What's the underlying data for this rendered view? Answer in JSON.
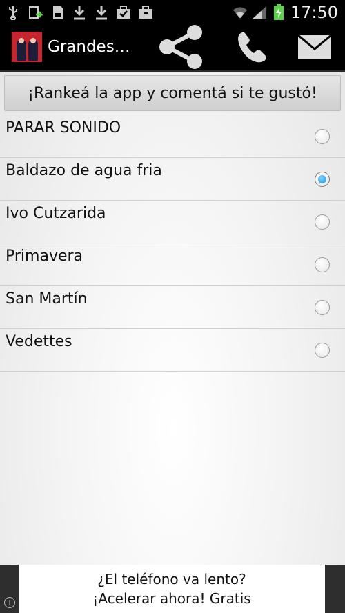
{
  "status_bar": {
    "time": "17:50",
    "icons": [
      "usb-icon",
      "refresh-icon",
      "sd-card-icon",
      "download-icon",
      "download-icon",
      "briefcase-check-icon",
      "briefcase-icon",
      "wifi-icon",
      "signal-icon",
      "battery-charging-icon"
    ]
  },
  "action_bar": {
    "title": "Grandes…",
    "actions": [
      "share-icon",
      "phone-icon",
      "mail-icon"
    ]
  },
  "rate_button": {
    "label": "¡Rankeá la app y comentá si te gustó!"
  },
  "sounds": [
    {
      "label": "PARAR SONIDO",
      "selected": false
    },
    {
      "label": "Baldazo de agua fria",
      "selected": true
    },
    {
      "label": "Ivo Cutzarida",
      "selected": false
    },
    {
      "label": "Primavera",
      "selected": false
    },
    {
      "label": "San Martín",
      "selected": false
    },
    {
      "label": "Vedettes",
      "selected": false
    }
  ],
  "ad": {
    "line1": "¿El teléfono va lento?",
    "line2": "¡Acelerar ahora! Gratis"
  },
  "colors": {
    "accent": "#1b93d6",
    "bar": "#000000"
  }
}
